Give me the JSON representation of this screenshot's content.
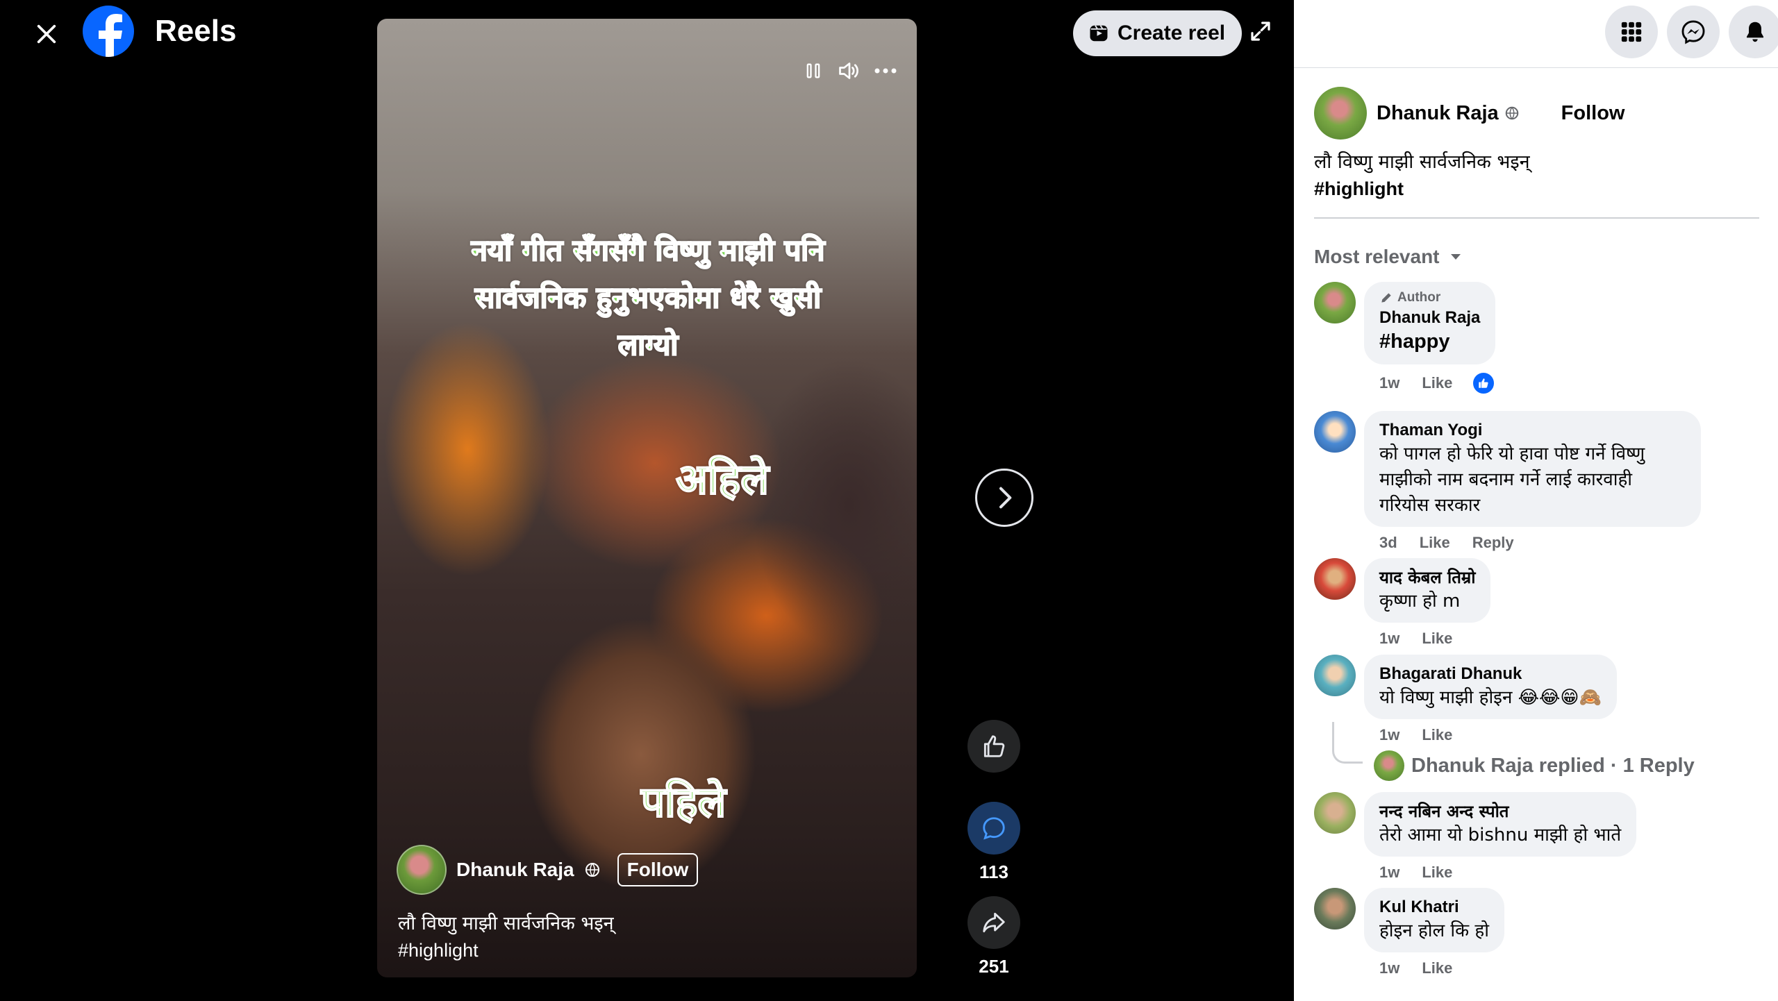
{
  "header": {
    "title": "Reels",
    "create_reel_label": "Create reel"
  },
  "video": {
    "overlay_main": "नयाँ गीत सँगसँगै विष्णु माझी पनि सार्वजनिक हुनुभएकोमा धेरै खुसी लाग्यो",
    "overlay_now": "अहिले",
    "overlay_before": "पहिले",
    "author_name": "Dhanuk Raja",
    "follow_label": "Follow",
    "caption_line1": "लौ विष्णु माझी सार्वजनिक भइन्",
    "caption_line2": "#highlight"
  },
  "actions": {
    "comments_count": "113",
    "shares_count": "251"
  },
  "post": {
    "author_name": "Dhanuk Raja",
    "follow_label": "Follow",
    "caption_line1": "लौ विष्णु माझी सार्वजनिक भइन्",
    "caption_line2": "#highlight",
    "sort_label": "Most relevant"
  },
  "comments": [
    {
      "author_tag": "Author",
      "name": "Dhanuk Raja",
      "text": "#happy",
      "time": "1w",
      "like": "Like"
    },
    {
      "name": "Thaman Yogi",
      "text": "को पागल हो फेरि यो हावा पोष्ट गर्ने विष्णु माझीको नाम बदनाम गर्ने लाई कारवाही गरियोस सरकार",
      "time": "3d",
      "like": "Like",
      "reply": "Reply"
    },
    {
      "name": "याद केबल तिम्रो",
      "text": "कृष्णा हो m",
      "time": "1w",
      "like": "Like"
    },
    {
      "name": "Bhagarati Dhanuk",
      "text": "यो विष्णु माझी होइन 😂😂😁🙈",
      "time": "1w",
      "like": "Like"
    },
    {
      "name": "नन्द नबिन अन्द स्पोत",
      "text": "तेरो आमा यो bishnu माझी हो भाते",
      "time": "1w",
      "like": "Like"
    },
    {
      "name": "Kul Khatri",
      "text": "होइन होल कि हो",
      "time": "1w",
      "like": "Like"
    }
  ],
  "replies": {
    "label": "Dhanuk Raja replied · 1 Reply"
  },
  "colors": {
    "brand": "#0866ff",
    "overlay_text": "#7ed957"
  }
}
